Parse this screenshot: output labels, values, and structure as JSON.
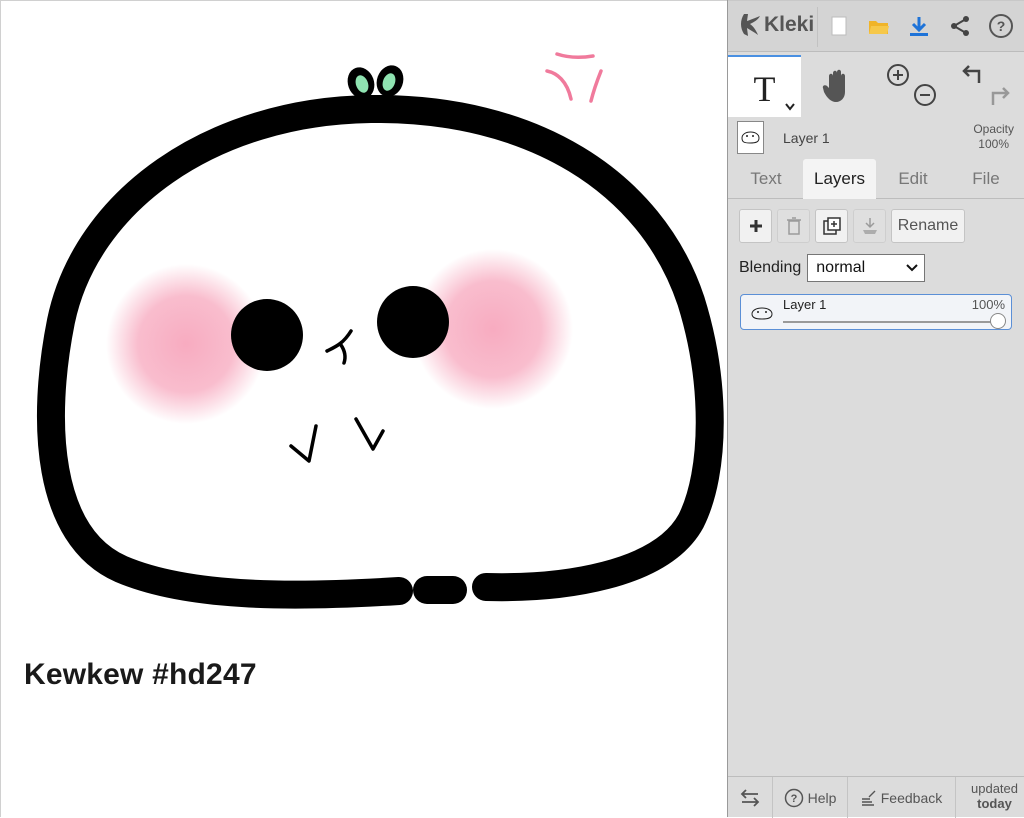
{
  "canvas": {
    "caption": "Kewkew #hd247"
  },
  "app": {
    "logo_text": "Kleki"
  },
  "toolbar": {
    "text_tool_glyph": "T",
    "icons": [
      "new-image-icon",
      "open-folder-icon",
      "download-icon",
      "share-icon",
      "help-icon"
    ]
  },
  "layer_info": {
    "name": "Layer 1",
    "opacity_label": "Opacity",
    "opacity_value": "100%"
  },
  "tabs": [
    {
      "label": "Text",
      "active": false
    },
    {
      "label": "Layers",
      "active": true
    },
    {
      "label": "Edit",
      "active": false
    },
    {
      "label": "File",
      "active": false
    }
  ],
  "layer_panel": {
    "rename_label": "Rename",
    "blending_label": "Blending",
    "blending_value": "normal",
    "layers": [
      {
        "name": "Layer 1",
        "opacity": "100%",
        "opacity_fraction": 1.0
      }
    ]
  },
  "footer": {
    "help_label": "Help",
    "feedback_label": "Feedback",
    "updated_line1": "updated",
    "updated_line2": "today"
  },
  "colors": {
    "accent": "#4a90e2",
    "download": "#1e73d8",
    "folder": "#f0b429",
    "blush": "#f7a7bd",
    "sprout": "#8fe3b1",
    "anger_mark": "#f07a9c"
  }
}
